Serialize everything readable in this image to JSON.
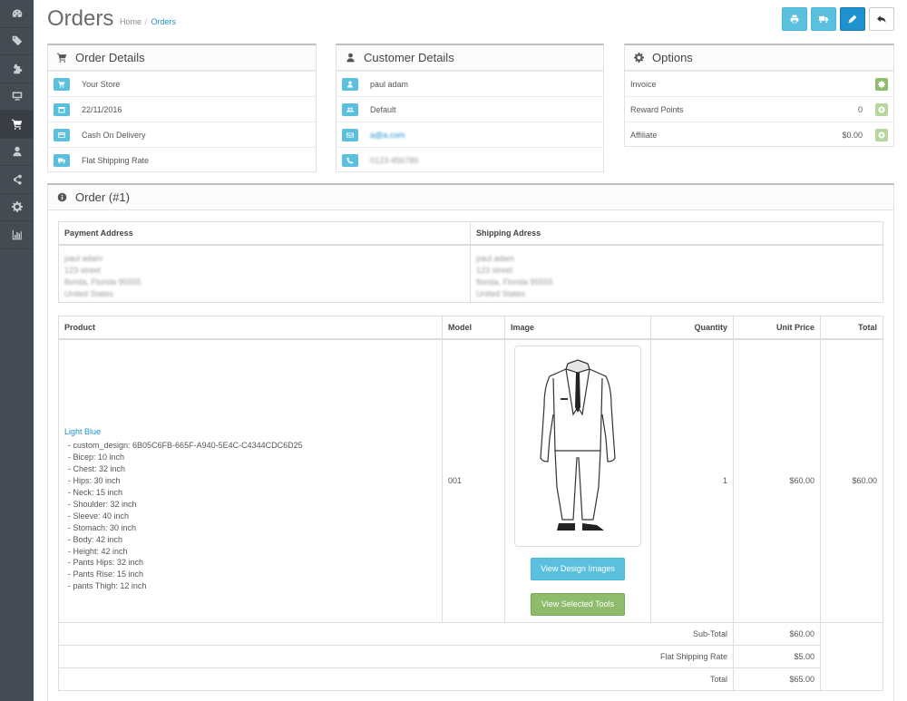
{
  "header": {
    "title": "Orders",
    "breadcrumb": [
      "Home",
      "Orders"
    ]
  },
  "sidebar": {
    "items": [
      "dashboard-icon",
      "tag-icon",
      "puzzle-icon",
      "desktop-icon",
      "cart-icon",
      "user-icon",
      "share-icon",
      "gear-icon",
      "bar-chart-icon"
    ],
    "active_index": 4
  },
  "order_details": {
    "title": "Order Details",
    "store": "Your Store",
    "date": "22/11/2016",
    "payment_method": "Cash On Delivery",
    "shipping_method": "Flat Shipping Rate"
  },
  "customer_details": {
    "title": "Customer Details",
    "name": "paul adam",
    "group": "Default",
    "email": "a@a.com",
    "phone": "0123-456789"
  },
  "options": {
    "title": "Options",
    "rows": [
      {
        "label": "Invoice",
        "value": ""
      },
      {
        "label": "Reward Points",
        "value": "0"
      },
      {
        "label": "Affiliate",
        "value": "$0.00"
      }
    ]
  },
  "order": {
    "title": "Order (#1)",
    "payment_address": {
      "heading": "Payment Address",
      "lines": [
        "paul adam",
        "123 street",
        "florida, Florida 95555",
        "United States"
      ]
    },
    "shipping_address": {
      "heading": "Shipping Adress",
      "lines": [
        "paul adam",
        "123 street",
        "florida, Florida 95555",
        "United States"
      ]
    },
    "columns": [
      "Product",
      "Model",
      "Image",
      "Quantity",
      "Unit Price",
      "Total"
    ],
    "product": {
      "name": "Light Blue",
      "options": [
        "- custom_design: 6B05C6FB-665F-A940-5E4C-C4344CDC6D25",
        "- Bicep: 10 inch",
        "- Chest: 32 inch",
        "- Hips: 30 inch",
        "- Neck: 15 inch",
        "- Shoulder: 32 inch",
        "- Sleeve: 40 inch",
        "- Stomach: 30 inch",
        "- Body: 42 inch",
        "- Height: 42 inch",
        "- Pants Hips: 32 inch",
        "- Pants Rise: 15 inch",
        "- pants Thigh: 12 inch"
      ],
      "model": "001",
      "quantity": "1",
      "unit_price": "$60.00",
      "total": "$60.00",
      "view_design_label": "View Design Images",
      "view_tools_label": "View Selected Tools"
    },
    "totals": [
      {
        "label": "Sub-Total",
        "value": "$60.00"
      },
      {
        "label": "Flat Shipping Rate",
        "value": "$5.00"
      },
      {
        "label": "Total",
        "value": "$65.00"
      }
    ]
  },
  "colors": {
    "sidebar": "#444b52",
    "info": "#5bc0de",
    "primary": "#1e91cf",
    "success": "#8fbb6c"
  }
}
